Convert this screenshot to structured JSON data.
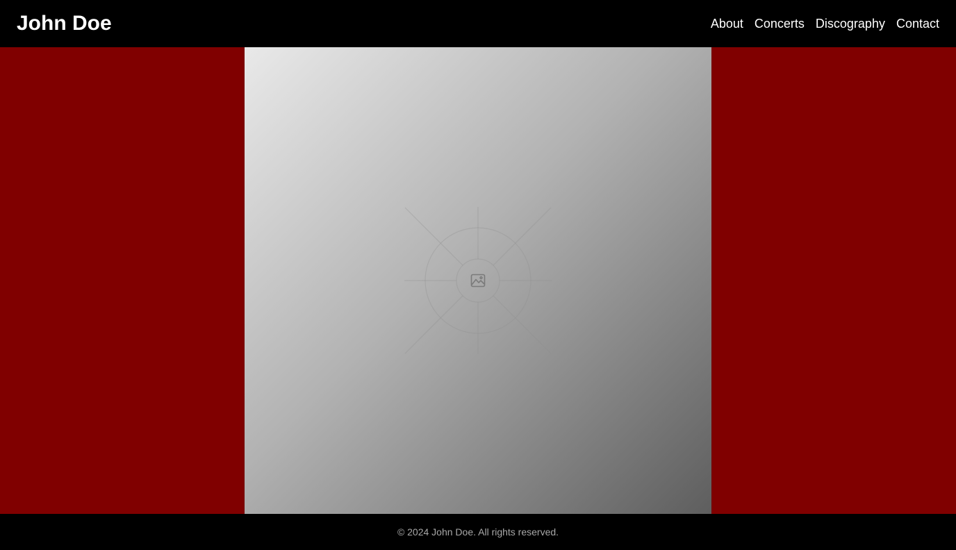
{
  "header": {
    "site_title": "John Doe",
    "nav": [
      {
        "label": "About"
      },
      {
        "label": "Concerts"
      },
      {
        "label": "Discography"
      },
      {
        "label": "Contact"
      }
    ]
  },
  "main": {
    "background_color": "#800000",
    "hero_image": {
      "icon": "image-icon"
    }
  },
  "footer": {
    "copyright": "© 2024 John Doe. All rights reserved."
  }
}
